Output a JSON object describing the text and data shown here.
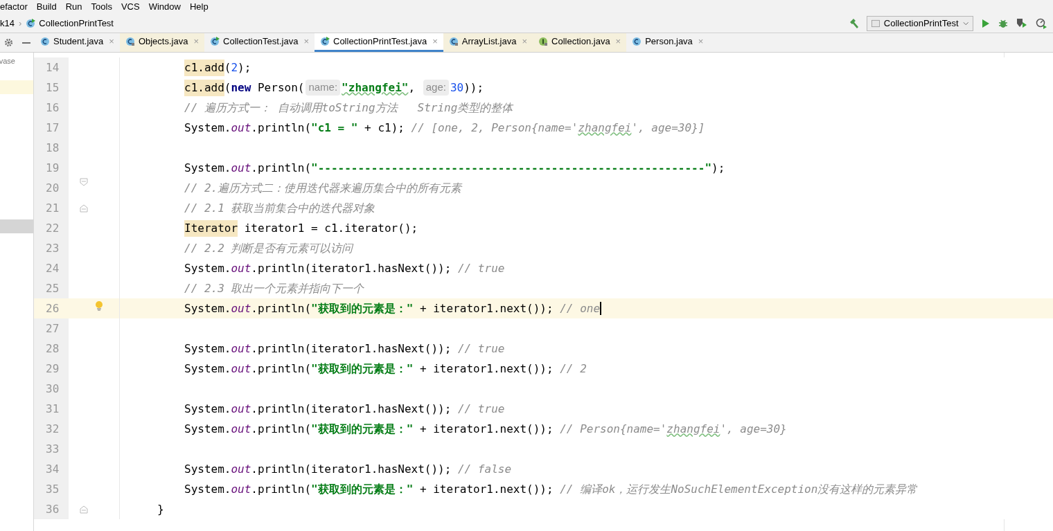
{
  "menu": [
    "efactor",
    "Build",
    "Run",
    "Tools",
    "VCS",
    "Window",
    "Help"
  ],
  "breadcrumb": {
    "items": [
      "k14",
      "CollectionPrintTest"
    ],
    "separator": "›"
  },
  "run_config": "CollectionPrintTest",
  "project_panel": {
    "text": "vase"
  },
  "tabs": [
    {
      "label": "Student.java",
      "kind": "class",
      "selected": false,
      "close": "×"
    },
    {
      "label": "Objects.java",
      "kind": "library-class",
      "selected": false,
      "close": "×"
    },
    {
      "label": "CollectionTest.java",
      "kind": "runnable",
      "selected": false,
      "close": "×"
    },
    {
      "label": "CollectionPrintTest.java",
      "kind": "runnable",
      "selected": true,
      "close": "×"
    },
    {
      "label": "ArrayList.java",
      "kind": "library-class",
      "selected": false,
      "close": "×"
    },
    {
      "label": "Collection.java",
      "kind": "library-interface",
      "selected": false,
      "close": "×"
    },
    {
      "label": "Person.java",
      "kind": "class",
      "selected": false,
      "close": "×"
    }
  ],
  "lines": [
    {
      "number": "14",
      "current": false,
      "kind": "plain",
      "tokens": [
        {
          "kind": "highlight",
          "text": "c1.add"
        },
        {
          "kind": "plain",
          "text": "("
        },
        {
          "kind": "number",
          "text": "2"
        },
        {
          "kind": "plain",
          "text": ");"
        }
      ]
    },
    {
      "number": "15",
      "current": false,
      "kind": "plain",
      "tokens": [
        {
          "kind": "highlight",
          "text": "c1.add"
        },
        {
          "kind": "plain",
          "text": "("
        },
        {
          "kind": "keyword",
          "text": "new"
        },
        {
          "kind": "plain",
          "text": " Person("
        },
        {
          "kind": "hint",
          "text": "name:"
        },
        {
          "kind": "string",
          "text": "\"zhangfei\"",
          "typo": true
        },
        {
          "kind": "plain",
          "text": ", "
        },
        {
          "kind": "hint",
          "text": "age:"
        },
        {
          "kind": "number",
          "text": "30"
        },
        {
          "kind": "plain",
          "text": "));"
        }
      ]
    },
    {
      "number": "16",
      "current": false,
      "kind": "plain",
      "tokens": [
        {
          "kind": "comment",
          "text": "// 遍历方式一： 自动调用toString方法   String类型的整体"
        }
      ]
    },
    {
      "number": "17",
      "current": false,
      "kind": "plain",
      "tokens": [
        {
          "kind": "plain",
          "text": "System."
        },
        {
          "kind": "field",
          "text": "out"
        },
        {
          "kind": "plain",
          "text": ".println("
        },
        {
          "kind": "string",
          "text": "\"c1 = \""
        },
        {
          "kind": "plain",
          "text": " + c1); "
        },
        {
          "kind": "comment",
          "text": "// [one, 2, Person{name='"
        },
        {
          "kind": "comment",
          "text": "zhangfei",
          "typo": true
        },
        {
          "kind": "comment",
          "text": "', age=30}]"
        }
      ]
    },
    {
      "number": "18",
      "current": false,
      "kind": "plain"
    },
    {
      "number": "19",
      "current": false,
      "kind": "plain",
      "tokens": [
        {
          "kind": "plain",
          "text": "System."
        },
        {
          "kind": "field",
          "text": "out"
        },
        {
          "kind": "plain",
          "text": ".println("
        },
        {
          "kind": "string",
          "text": "\"----------------------------------------------------------\""
        },
        {
          "kind": "plain",
          "text": ");"
        }
      ]
    },
    {
      "number": "20",
      "current": false,
      "kind": "fold-start",
      "tokens": [
        {
          "kind": "comment",
          "text": "// 2.遍历方式二：使用迭代器来遍历集合中的所有元素"
        }
      ]
    },
    {
      "number": "21",
      "current": false,
      "kind": "fold-end",
      "tokens": [
        {
          "kind": "comment",
          "text": "// 2.1 获取当前集合中的迭代器对象"
        }
      ]
    },
    {
      "number": "22",
      "current": false,
      "kind": "plain",
      "tokens": [
        {
          "kind": "highlight",
          "text": "Iterator"
        },
        {
          "kind": "plain",
          "text": " iterator1 = c1.iterator();"
        }
      ]
    },
    {
      "number": "23",
      "current": false,
      "kind": "plain",
      "tokens": [
        {
          "kind": "comment",
          "text": "// 2.2 判断是否有元素可以访问"
        }
      ]
    },
    {
      "number": "24",
      "current": false,
      "kind": "plain",
      "tokens": [
        {
          "kind": "plain",
          "text": "System."
        },
        {
          "kind": "field",
          "text": "out"
        },
        {
          "kind": "plain",
          "text": ".println(iterator1.hasNext()); "
        },
        {
          "kind": "comment",
          "text": "// true"
        }
      ]
    },
    {
      "number": "25",
      "current": false,
      "kind": "plain",
      "tokens": [
        {
          "kind": "comment",
          "text": "// 2.3 取出一个元素并指向下一个"
        }
      ]
    },
    {
      "number": "26",
      "current": true,
      "kind": "bulb",
      "tokens": [
        {
          "kind": "plain",
          "text": "System."
        },
        {
          "kind": "field",
          "text": "out"
        },
        {
          "kind": "plain",
          "text": ".println("
        },
        {
          "kind": "string",
          "text": "\"获取到的元素是：\""
        },
        {
          "kind": "plain",
          "text": " + iterator1.next()); "
        },
        {
          "kind": "comment",
          "text": "// one"
        }
      ]
    },
    {
      "number": "27",
      "current": false,
      "kind": "plain"
    },
    {
      "number": "28",
      "current": false,
      "kind": "plain",
      "tokens": [
        {
          "kind": "plain",
          "text": "System."
        },
        {
          "kind": "field",
          "text": "out"
        },
        {
          "kind": "plain",
          "text": ".println(iterator1.hasNext()); "
        },
        {
          "kind": "comment",
          "text": "// true"
        }
      ]
    },
    {
      "number": "29",
      "current": false,
      "kind": "plain",
      "tokens": [
        {
          "kind": "plain",
          "text": "System."
        },
        {
          "kind": "field",
          "text": "out"
        },
        {
          "kind": "plain",
          "text": ".println("
        },
        {
          "kind": "string",
          "text": "\"获取到的元素是：\""
        },
        {
          "kind": "plain",
          "text": " + iterator1.next()); "
        },
        {
          "kind": "comment",
          "text": "// 2"
        }
      ]
    },
    {
      "number": "30",
      "current": false,
      "kind": "plain"
    },
    {
      "number": "31",
      "current": false,
      "kind": "plain",
      "tokens": [
        {
          "kind": "plain",
          "text": "System."
        },
        {
          "kind": "field",
          "text": "out"
        },
        {
          "kind": "plain",
          "text": ".println(iterator1.hasNext()); "
        },
        {
          "kind": "comment",
          "text": "// true"
        }
      ]
    },
    {
      "number": "32",
      "current": false,
      "kind": "plain",
      "tokens": [
        {
          "kind": "plain",
          "text": "System."
        },
        {
          "kind": "field",
          "text": "out"
        },
        {
          "kind": "plain",
          "text": ".println("
        },
        {
          "kind": "string",
          "text": "\"获取到的元素是：\""
        },
        {
          "kind": "plain",
          "text": " + iterator1.next()); "
        },
        {
          "kind": "comment",
          "text": "// Person{name='"
        },
        {
          "kind": "comment",
          "text": "zhangfei",
          "typo": true
        },
        {
          "kind": "comment",
          "text": "', age=30}"
        }
      ]
    },
    {
      "number": "33",
      "current": false,
      "kind": "plain"
    },
    {
      "number": "34",
      "current": false,
      "kind": "plain",
      "tokens": [
        {
          "kind": "plain",
          "text": "System."
        },
        {
          "kind": "field",
          "text": "out"
        },
        {
          "kind": "plain",
          "text": ".println(iterator1.hasNext()); "
        },
        {
          "kind": "comment",
          "text": "// false"
        }
      ]
    },
    {
      "number": "35",
      "current": false,
      "kind": "plain",
      "tokens": [
        {
          "kind": "plain",
          "text": "System."
        },
        {
          "kind": "field",
          "text": "out"
        },
        {
          "kind": "plain",
          "text": ".println("
        },
        {
          "kind": "string",
          "text": "\"获取到的元素是：\""
        },
        {
          "kind": "plain",
          "text": " + iterator1.next()); "
        },
        {
          "kind": "comment",
          "text": "// 编译ok，运行发生NoSuchElementException没有这样的元素异常"
        }
      ]
    },
    {
      "number": "36",
      "current": false,
      "kind": "block-close",
      "tokens": [
        {
          "kind": "plain",
          "text": "}"
        }
      ]
    }
  ]
}
